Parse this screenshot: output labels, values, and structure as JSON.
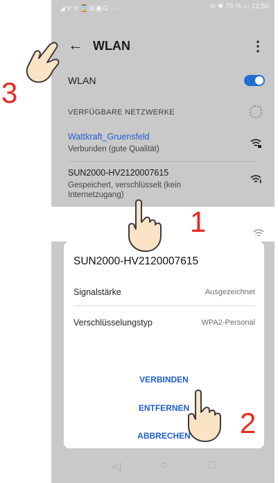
{
  "status": {
    "left_icons": "◢ᯤᯤ⌛⊞▣G ⋯",
    "right": "⊘ ✱ 76 % ▭ 12:50"
  },
  "header": {
    "back_icon": "arrow-left-icon",
    "title": "WLAN",
    "menu_icon": "more-vert-icon"
  },
  "wlan": {
    "label": "WLAN",
    "enabled": true
  },
  "networks": {
    "section_title": "VERFÜGBARE NETZWERKE",
    "items": [
      {
        "name": "Wattkraft_Gruensfeld",
        "status": "Verbunden (gute Qualität)"
      },
      {
        "name": "SUN2000-HV2120007615",
        "status": "Gespeichert, verschlüsselt (kein Internetzugang)"
      }
    ]
  },
  "dialog": {
    "title": "SUN2000-HV2120007615",
    "rows": [
      {
        "label": "Signalstärke",
        "value": "Ausgezeichnet"
      },
      {
        "label": "Verschlüsselungstyp",
        "value": "WPA2-Personal"
      }
    ],
    "buttons": {
      "connect": "VERBINDEN",
      "remove": "ENTFERNEN",
      "cancel": "ABBRECHEN"
    }
  },
  "navbar": {
    "back": "◁",
    "home": "○",
    "recent": "□"
  },
  "steps": {
    "one": "1",
    "two": "2",
    "three": "3"
  },
  "colors": {
    "accent": "#1f5ed6",
    "step": "#e8291c"
  }
}
